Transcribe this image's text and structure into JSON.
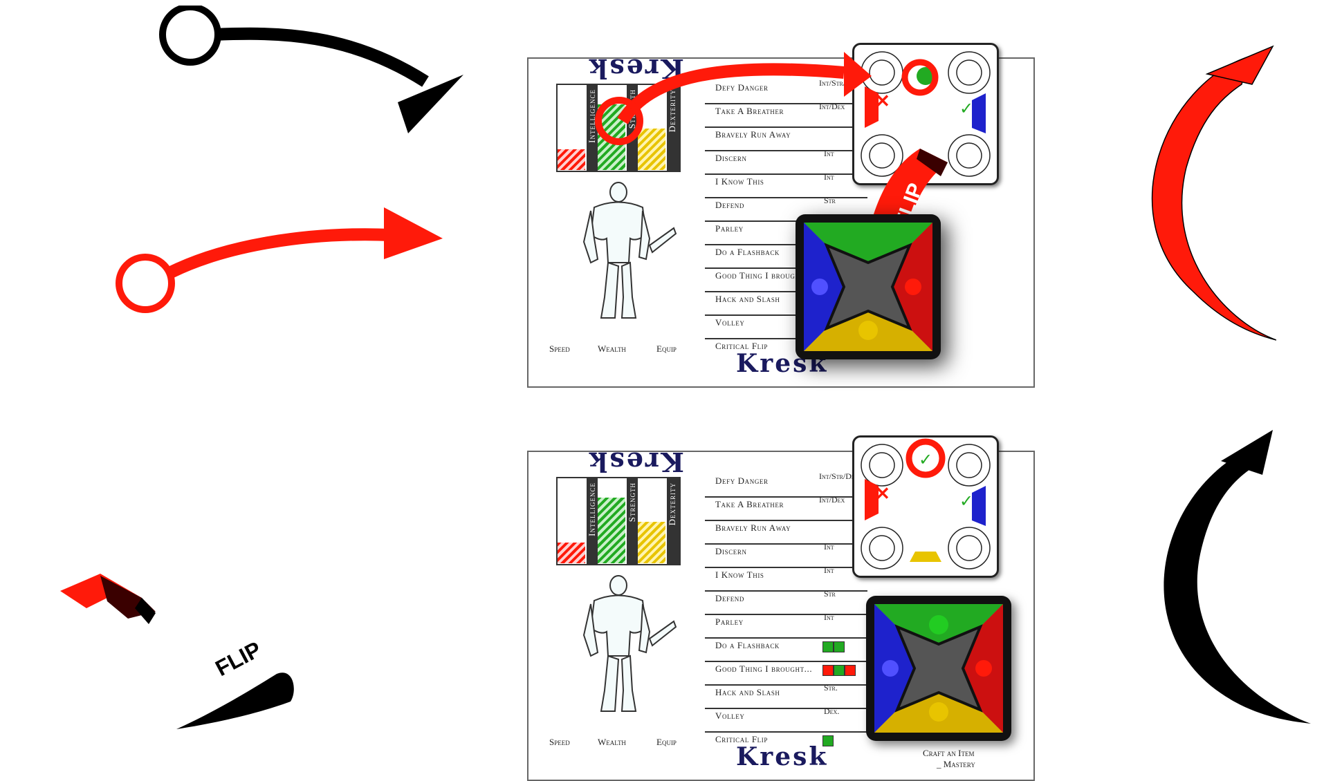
{
  "character_name": "Kresk",
  "stats": [
    "Intelligence",
    "Strength",
    "Dexterity"
  ],
  "bottom_labels": [
    "Speed",
    "Wealth",
    "Equip"
  ],
  "moves_top": [
    {
      "name": "Defy Danger",
      "stat": "Int/Str/Dex"
    },
    {
      "name": "Take A Breather",
      "stat": "Int/Dex"
    },
    {
      "name": "Bravely Run Away",
      "stat": ""
    },
    {
      "name": "Discern",
      "stat": "Int"
    },
    {
      "name": "I Know This",
      "stat": "Int"
    },
    {
      "name": "Defend",
      "stat": "Str"
    },
    {
      "name": "Parley",
      "stat": ""
    },
    {
      "name": "Do a Flashback",
      "stat": ""
    },
    {
      "name": "Good Thing I brough",
      "stat": ""
    },
    {
      "name": "Hack and Slash",
      "stat": ""
    },
    {
      "name": "Volley",
      "stat": ""
    },
    {
      "name": "Critical Flip",
      "stat": ""
    }
  ],
  "moves_bottom": [
    {
      "name": "Defy Danger",
      "stat": "Int/Str/Dex"
    },
    {
      "name": "Take A Breather",
      "stat": "Int/Dex"
    },
    {
      "name": "Bravely Run Away",
      "stat": ""
    },
    {
      "name": "Discern",
      "stat": "Int"
    },
    {
      "name": "I Know This",
      "stat": "Int"
    },
    {
      "name": "Defend",
      "stat": "Str"
    },
    {
      "name": "Parley",
      "stat": "Int"
    },
    {
      "name": "Do a Flashback",
      "stat": ""
    },
    {
      "name": "Good Thing I brought...",
      "stat": ""
    },
    {
      "name": "Hack and Slash",
      "stat": "Str."
    },
    {
      "name": "Volley",
      "stat": "Dex."
    },
    {
      "name": "Critical Flip",
      "stat": ""
    }
  ],
  "flip_label": "FLIP",
  "craft_label": "Craft an Item",
  "mastery_label": "_ Mastery",
  "colors": {
    "red": "#ff1a0a",
    "black": "#000000",
    "green": "#22aa22",
    "blue": "#1e22cc",
    "yellow": "#e8c400"
  }
}
